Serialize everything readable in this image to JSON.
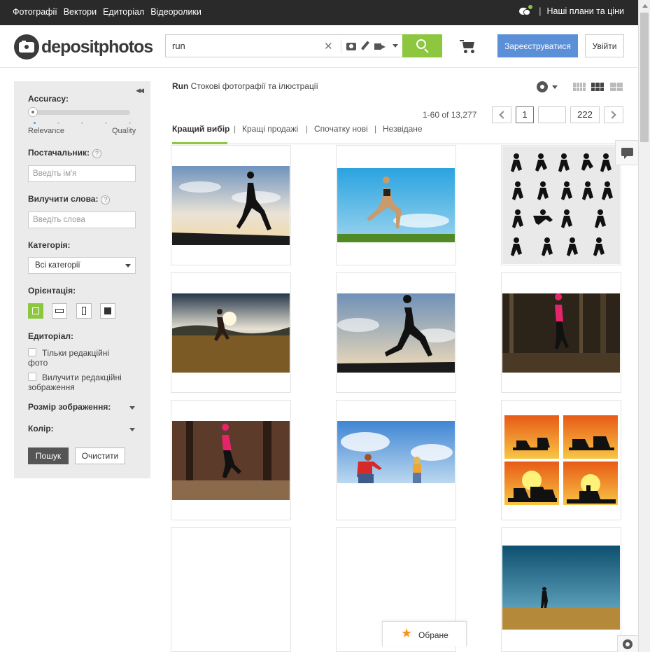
{
  "topbar": {
    "nav": [
      "Фотографії",
      "Вектори",
      "Едиторіал",
      "Відеоролики"
    ],
    "plans_label": "Наші плани та ціни"
  },
  "header": {
    "logo_text": "depositphotos",
    "search_value": "run",
    "register_label": "Зареєструватися",
    "login_label": "Увійти"
  },
  "sidebar": {
    "accuracy_label": "Accuracy:",
    "accuracy_value": 0,
    "relevance_label": "Relevance",
    "quality_label": "Quality",
    "supplier_label": "Постачальник:",
    "supplier_placeholder": "Введіть ім'я",
    "exclude_label": "Вилучити слова:",
    "exclude_placeholder": "Введіть слова",
    "category_label": "Категорія:",
    "category_value": "Всі категорії",
    "orientation_label": "Орієнтація:",
    "editorial_label": "Едиторіал:",
    "editorial_only_label": "Тільки редакційні фото",
    "exclude_editorial_label": "Вилучити редакційні зображення",
    "size_label": "Розмір зображення:",
    "color_label": "Колір:",
    "find_label": "Пошук",
    "clear_label": "Очистити",
    "help_symbol": "?"
  },
  "main": {
    "query": "Run",
    "breadcrumb_suffix": "Стокові фотографії та ілюстрації",
    "result_count": "1-60 of 13,277",
    "current_page": "1",
    "page_input": "",
    "total_pages": "222",
    "tabs": [
      "Кращий вибір",
      "Кращі продажі",
      "Спочатку нові",
      "Незвідане"
    ],
    "tab_separator": "|"
  },
  "footer": {
    "favorites_label": "Обране"
  }
}
